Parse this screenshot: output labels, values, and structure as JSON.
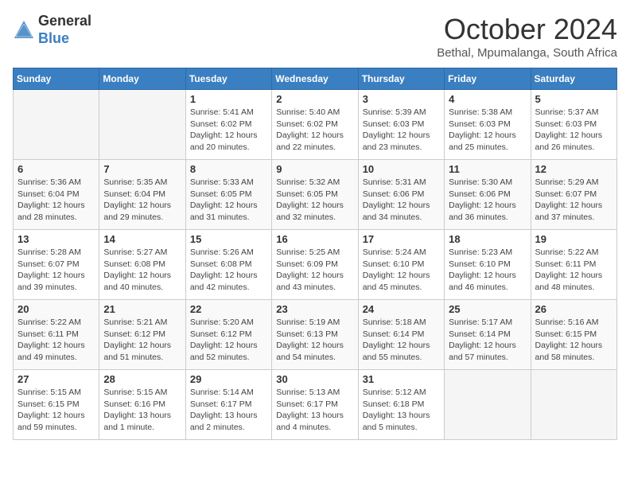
{
  "logo": {
    "general": "General",
    "blue": "Blue"
  },
  "header": {
    "month": "October 2024",
    "location": "Bethal, Mpumalanga, South Africa"
  },
  "weekdays": [
    "Sunday",
    "Monday",
    "Tuesday",
    "Wednesday",
    "Thursday",
    "Friday",
    "Saturday"
  ],
  "weeks": [
    [
      {
        "day": "",
        "empty": true
      },
      {
        "day": "",
        "empty": true
      },
      {
        "day": "1",
        "sunrise": "Sunrise: 5:41 AM",
        "sunset": "Sunset: 6:02 PM",
        "daylight": "Daylight: 12 hours and 20 minutes."
      },
      {
        "day": "2",
        "sunrise": "Sunrise: 5:40 AM",
        "sunset": "Sunset: 6:02 PM",
        "daylight": "Daylight: 12 hours and 22 minutes."
      },
      {
        "day": "3",
        "sunrise": "Sunrise: 5:39 AM",
        "sunset": "Sunset: 6:03 PM",
        "daylight": "Daylight: 12 hours and 23 minutes."
      },
      {
        "day": "4",
        "sunrise": "Sunrise: 5:38 AM",
        "sunset": "Sunset: 6:03 PM",
        "daylight": "Daylight: 12 hours and 25 minutes."
      },
      {
        "day": "5",
        "sunrise": "Sunrise: 5:37 AM",
        "sunset": "Sunset: 6:03 PM",
        "daylight": "Daylight: 12 hours and 26 minutes."
      }
    ],
    [
      {
        "day": "6",
        "sunrise": "Sunrise: 5:36 AM",
        "sunset": "Sunset: 6:04 PM",
        "daylight": "Daylight: 12 hours and 28 minutes."
      },
      {
        "day": "7",
        "sunrise": "Sunrise: 5:35 AM",
        "sunset": "Sunset: 6:04 PM",
        "daylight": "Daylight: 12 hours and 29 minutes."
      },
      {
        "day": "8",
        "sunrise": "Sunrise: 5:33 AM",
        "sunset": "Sunset: 6:05 PM",
        "daylight": "Daylight: 12 hours and 31 minutes."
      },
      {
        "day": "9",
        "sunrise": "Sunrise: 5:32 AM",
        "sunset": "Sunset: 6:05 PM",
        "daylight": "Daylight: 12 hours and 32 minutes."
      },
      {
        "day": "10",
        "sunrise": "Sunrise: 5:31 AM",
        "sunset": "Sunset: 6:06 PM",
        "daylight": "Daylight: 12 hours and 34 minutes."
      },
      {
        "day": "11",
        "sunrise": "Sunrise: 5:30 AM",
        "sunset": "Sunset: 6:06 PM",
        "daylight": "Daylight: 12 hours and 36 minutes."
      },
      {
        "day": "12",
        "sunrise": "Sunrise: 5:29 AM",
        "sunset": "Sunset: 6:07 PM",
        "daylight": "Daylight: 12 hours and 37 minutes."
      }
    ],
    [
      {
        "day": "13",
        "sunrise": "Sunrise: 5:28 AM",
        "sunset": "Sunset: 6:07 PM",
        "daylight": "Daylight: 12 hours and 39 minutes."
      },
      {
        "day": "14",
        "sunrise": "Sunrise: 5:27 AM",
        "sunset": "Sunset: 6:08 PM",
        "daylight": "Daylight: 12 hours and 40 minutes."
      },
      {
        "day": "15",
        "sunrise": "Sunrise: 5:26 AM",
        "sunset": "Sunset: 6:08 PM",
        "daylight": "Daylight: 12 hours and 42 minutes."
      },
      {
        "day": "16",
        "sunrise": "Sunrise: 5:25 AM",
        "sunset": "Sunset: 6:09 PM",
        "daylight": "Daylight: 12 hours and 43 minutes."
      },
      {
        "day": "17",
        "sunrise": "Sunrise: 5:24 AM",
        "sunset": "Sunset: 6:10 PM",
        "daylight": "Daylight: 12 hours and 45 minutes."
      },
      {
        "day": "18",
        "sunrise": "Sunrise: 5:23 AM",
        "sunset": "Sunset: 6:10 PM",
        "daylight": "Daylight: 12 hours and 46 minutes."
      },
      {
        "day": "19",
        "sunrise": "Sunrise: 5:22 AM",
        "sunset": "Sunset: 6:11 PM",
        "daylight": "Daylight: 12 hours and 48 minutes."
      }
    ],
    [
      {
        "day": "20",
        "sunrise": "Sunrise: 5:22 AM",
        "sunset": "Sunset: 6:11 PM",
        "daylight": "Daylight: 12 hours and 49 minutes."
      },
      {
        "day": "21",
        "sunrise": "Sunrise: 5:21 AM",
        "sunset": "Sunset: 6:12 PM",
        "daylight": "Daylight: 12 hours and 51 minutes."
      },
      {
        "day": "22",
        "sunrise": "Sunrise: 5:20 AM",
        "sunset": "Sunset: 6:12 PM",
        "daylight": "Daylight: 12 hours and 52 minutes."
      },
      {
        "day": "23",
        "sunrise": "Sunrise: 5:19 AM",
        "sunset": "Sunset: 6:13 PM",
        "daylight": "Daylight: 12 hours and 54 minutes."
      },
      {
        "day": "24",
        "sunrise": "Sunrise: 5:18 AM",
        "sunset": "Sunset: 6:14 PM",
        "daylight": "Daylight: 12 hours and 55 minutes."
      },
      {
        "day": "25",
        "sunrise": "Sunrise: 5:17 AM",
        "sunset": "Sunset: 6:14 PM",
        "daylight": "Daylight: 12 hours and 57 minutes."
      },
      {
        "day": "26",
        "sunrise": "Sunrise: 5:16 AM",
        "sunset": "Sunset: 6:15 PM",
        "daylight": "Daylight: 12 hours and 58 minutes."
      }
    ],
    [
      {
        "day": "27",
        "sunrise": "Sunrise: 5:15 AM",
        "sunset": "Sunset: 6:15 PM",
        "daylight": "Daylight: 12 hours and 59 minutes."
      },
      {
        "day": "28",
        "sunrise": "Sunrise: 5:15 AM",
        "sunset": "Sunset: 6:16 PM",
        "daylight": "Daylight: 13 hours and 1 minute."
      },
      {
        "day": "29",
        "sunrise": "Sunrise: 5:14 AM",
        "sunset": "Sunset: 6:17 PM",
        "daylight": "Daylight: 13 hours and 2 minutes."
      },
      {
        "day": "30",
        "sunrise": "Sunrise: 5:13 AM",
        "sunset": "Sunset: 6:17 PM",
        "daylight": "Daylight: 13 hours and 4 minutes."
      },
      {
        "day": "31",
        "sunrise": "Sunrise: 5:12 AM",
        "sunset": "Sunset: 6:18 PM",
        "daylight": "Daylight: 13 hours and 5 minutes."
      },
      {
        "day": "",
        "empty": true
      },
      {
        "day": "",
        "empty": true
      }
    ]
  ]
}
